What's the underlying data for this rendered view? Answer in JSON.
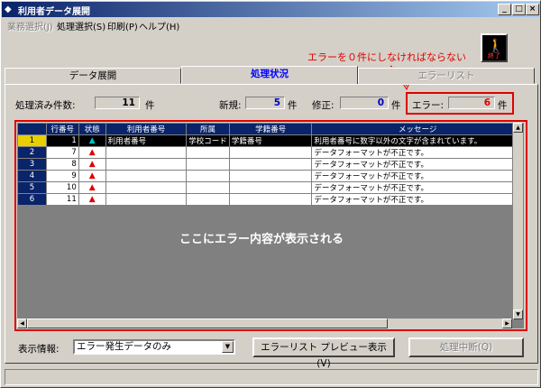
{
  "window": {
    "title": "利用者データ展開",
    "min": "_",
    "max": "□",
    "close": "×"
  },
  "menus": [
    {
      "label": "業務選択(J)",
      "enabled": false
    },
    {
      "label": "処理選択(S)",
      "enabled": true
    },
    {
      "label": "印刷(P)",
      "enabled": true
    },
    {
      "label": "ヘルプ(H)",
      "enabled": true
    }
  ],
  "exit_button": {
    "label": "終了",
    "icon": "exit-figure-icon"
  },
  "annotation": "エラーを０件にしなければならない",
  "tabs": [
    {
      "label": "データ展開",
      "active": false
    },
    {
      "label": "処理状況",
      "active": true
    },
    {
      "label": "エラーリスト",
      "active": false
    }
  ],
  "counts": {
    "processed_label": "処理済み件数:",
    "processed": "11",
    "processed_unit": "件",
    "new_label": "新規:",
    "new": "5",
    "new_unit": "件",
    "modified_label": "修正:",
    "modified": "0",
    "modified_unit": "件",
    "error_label": "エラー:",
    "error": "6",
    "error_unit": "件"
  },
  "grid": {
    "columns": [
      "行番号",
      "状態",
      "利用者番号",
      "所属",
      "学籍番号",
      "メッセージ"
    ],
    "rows": [
      {
        "no": "1",
        "line": "1",
        "status": "cyan-warning-icon",
        "user_no": "利用者番号",
        "dept": "学校コード",
        "student_no": "学籍番号",
        "message": "利用者番号に数字以外の文字が含まれています。"
      },
      {
        "no": "2",
        "line": "7",
        "status": "red-warning-icon",
        "user_no": "",
        "dept": "",
        "student_no": "",
        "message": "データフォーマットが不正です。"
      },
      {
        "no": "3",
        "line": "8",
        "status": "red-warning-icon",
        "user_no": "",
        "dept": "",
        "student_no": "",
        "message": "データフォーマットが不正です。"
      },
      {
        "no": "4",
        "line": "9",
        "status": "red-warning-icon",
        "user_no": "",
        "dept": "",
        "student_no": "",
        "message": "データフォーマットが不正です。"
      },
      {
        "no": "5",
        "line": "10",
        "status": "red-warning-icon",
        "user_no": "",
        "dept": "",
        "student_no": "",
        "message": "データフォーマットが不正です。"
      },
      {
        "no": "6",
        "line": "11",
        "status": "red-warning-icon",
        "user_no": "",
        "dept": "",
        "student_no": "",
        "message": "データフォーマットが不正です。"
      }
    ],
    "overlay_text": "ここにエラー内容が表示される"
  },
  "display_info": {
    "label": "表示情報:",
    "selected": "エラー発生データのみ"
  },
  "buttons": {
    "preview": "エラーリスト プレビュー表示(V)",
    "stop": "処理中断(Q)"
  }
}
